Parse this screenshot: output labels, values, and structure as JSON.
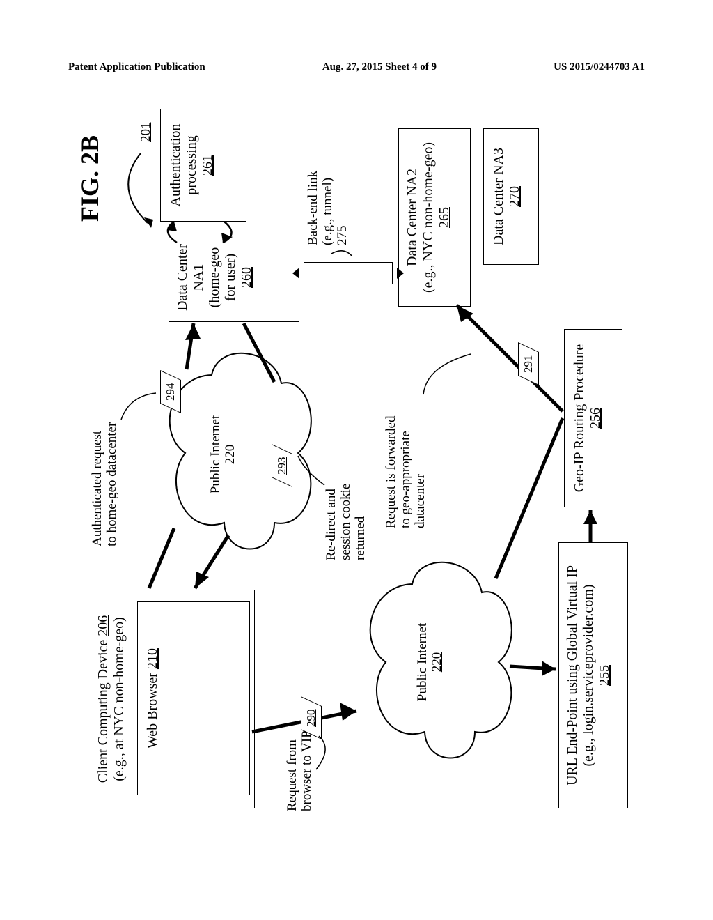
{
  "header": {
    "left": "Patent Application Publication",
    "center": "Aug. 27, 2015  Sheet 4 of 9",
    "right": "US 2015/0244703 A1"
  },
  "figure": {
    "title": "FIG. 2B",
    "ref": "201"
  },
  "client": {
    "title_line1": "Client Computing Device",
    "title_ref": "206",
    "subtitle": "(e.g., at NYC non-home-geo)",
    "browser_label": "Web Browser",
    "browser_ref": "210"
  },
  "internet1": {
    "label": "Public Internet",
    "ref": "220"
  },
  "internet2": {
    "label": "Public Internet",
    "ref": "220"
  },
  "vip": {
    "line1": "URL End-Point using Global Virtual IP",
    "line2": "(e.g., login.serviceprovider.com)",
    "ref": "255"
  },
  "geo_ip": {
    "label": "Geo-IP Routing Procedure",
    "ref": "256"
  },
  "dc_na1": {
    "line1": "Data Center NA1",
    "line2": "(home-geo for user)",
    "ref": "260"
  },
  "auth": {
    "line1": "Authentication",
    "line2": "processing",
    "ref": "261"
  },
  "dc_na2": {
    "line1": "Data Center NA2",
    "line2": "(e.g., NYC non-home-geo)",
    "ref": "265"
  },
  "dc_na3": {
    "line1": "Data Center NA3",
    "ref": "270"
  },
  "tunnel": {
    "line1": "Back-end link",
    "line2": "(e.g., tunnel)",
    "ref": "275"
  },
  "steps": {
    "s290": "290",
    "s291": "291",
    "s293": "293",
    "s294": "294"
  },
  "annotations": {
    "req_browser": "Request from\nbrowser to VIP",
    "forwarded": "Request is forwarded\nto geo-appropriate\ndatacenter",
    "redirect": "Re-direct and\nsession cookie\nreturned",
    "auth_req": "Authenticated request\nto home-geo datacenter"
  },
  "chart_data": {
    "type": "diagram",
    "nodes": [
      {
        "id": "206",
        "name": "Client Computing Device",
        "subtitle": "(e.g., at NYC non-home-geo)",
        "children": [
          {
            "id": "210",
            "name": "Web Browser"
          }
        ]
      },
      {
        "id": "220a",
        "name": "Public Internet",
        "ref": "220"
      },
      {
        "id": "220b",
        "name": "Public Internet",
        "ref": "220"
      },
      {
        "id": "255",
        "name": "URL End-Point using Global Virtual IP",
        "subtitle": "(e.g., login.serviceprovider.com)"
      },
      {
        "id": "256",
        "name": "Geo-IP Routing Procedure"
      },
      {
        "id": "260",
        "name": "Data Center NA1",
        "subtitle": "(home-geo for user)"
      },
      {
        "id": "261",
        "name": "Authentication processing"
      },
      {
        "id": "265",
        "name": "Data Center NA2",
        "subtitle": "(e.g., NYC non-home-geo)"
      },
      {
        "id": "270",
        "name": "Data Center NA3"
      },
      {
        "id": "275",
        "name": "Back-end link (e.g., tunnel)"
      }
    ],
    "edges": [
      {
        "seq": "290",
        "from": "210",
        "via": "220a",
        "to": "255",
        "label": "Request from browser to VIP"
      },
      {
        "from": "255",
        "to": "256"
      },
      {
        "seq": "291",
        "from": "256",
        "via": "220a",
        "to": "265",
        "label": "Request is forwarded to geo-appropriate datacenter"
      },
      {
        "from": "265",
        "via": "275",
        "to": "260",
        "label": "Back-end link (e.g., tunnel)"
      },
      {
        "from": "260",
        "to": "261"
      },
      {
        "from": "261",
        "to": "260"
      },
      {
        "seq": "293",
        "from": "260",
        "via": "220b",
        "to": "210",
        "label": "Re-direct and session cookie returned"
      },
      {
        "seq": "294",
        "from": "210",
        "via": "220b",
        "to": "260",
        "label": "Authenticated request to home-geo datacenter"
      }
    ],
    "figure_number": "201"
  }
}
